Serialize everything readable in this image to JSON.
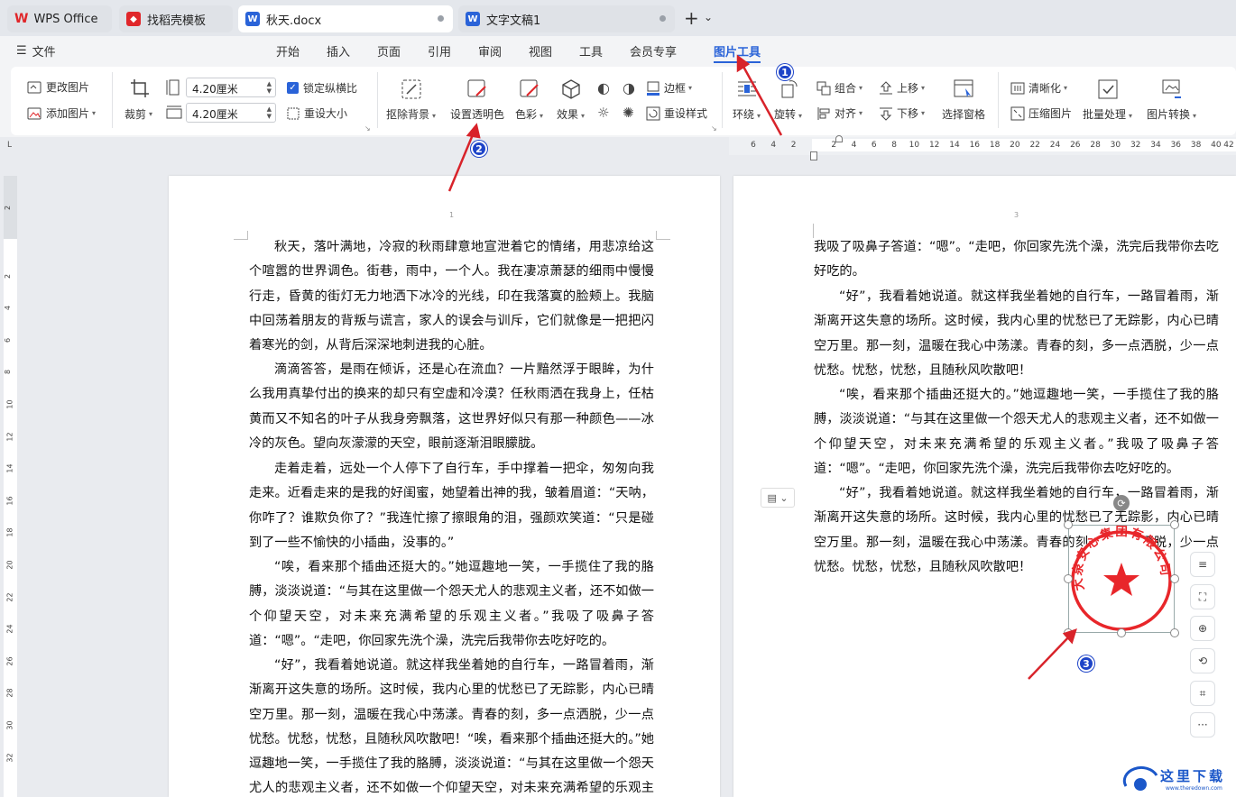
{
  "tabs": [
    {
      "label": "WPS Office",
      "icon": "wps-logo-icon"
    },
    {
      "label": "找稻壳模板",
      "icon": "docer-icon"
    },
    {
      "label": "秋天.docx",
      "icon": "word-doc-icon"
    },
    {
      "label": "文字文稿1",
      "icon": "word-doc-icon"
    }
  ],
  "tab_actions": {
    "new_tab": "+",
    "menu": "⌄"
  },
  "menu": {
    "file": "文件",
    "items": [
      "开始",
      "插入",
      "页面",
      "引用",
      "审阅",
      "视图",
      "工具",
      "会员专享",
      "图片工具"
    ],
    "active": "图片工具"
  },
  "ribbon": {
    "change_picture": "更改图片",
    "add_picture": "添加图片",
    "crop": "裁剪",
    "height_value": "4.20厘米",
    "width_value": "4.20厘米",
    "lock_ratio": "锁定纵横比",
    "reset_size": "重设大小",
    "remove_bg": "抠除背景",
    "set_transparent": "设置透明色",
    "color": "色彩",
    "effect": "效果",
    "border": "边框",
    "reset_style": "重设样式",
    "wrap": "环绕",
    "rotate": "旋转",
    "group": "组合",
    "align": "对齐",
    "move_up": "上移",
    "move_down": "下移",
    "selection_pane": "选择窗格",
    "sharpen": "清晰化",
    "compress": "压缩图片",
    "batch": "批量处理",
    "convert": "图片转换"
  },
  "ruler": {
    "h": [
      "6",
      "4",
      "2",
      "2",
      "4",
      "6",
      "8",
      "10",
      "12",
      "14",
      "16",
      "18",
      "20",
      "22",
      "24",
      "26",
      "28",
      "30",
      "32",
      "34",
      "36",
      "38",
      "40",
      "42"
    ],
    "v": [
      "2",
      "2",
      "4",
      "6",
      "8",
      "10",
      "12",
      "14",
      "16",
      "18",
      "20",
      "22",
      "24",
      "26",
      "28",
      "30",
      "32"
    ]
  },
  "page1": {
    "page_number": "1",
    "paragraphs": [
      "秋天，落叶满地，冷寂的秋雨肆意地宣泄着它的情绪，用悲凉给这个喧嚣的世界调色。街巷，雨中，一个人。我在凄凉萧瑟的细雨中慢慢行走，昏黄的街灯无力地洒下冰冷的光线，印在我落寞的脸颊上。我脑中回荡着朋友的背叛与谎言，家人的误会与训斥，它们就像是一把把闪着寒光的剑，从背后深深地刺进我的心脏。",
      "滴滴答答，是雨在倾诉，还是心在流血？一片黯然浮于眼眸，为什么我用真挚付出的换来的却只有空虚和冷漠？任秋雨洒在我身上，任枯黄而又不知名的叶子从我身旁飘落，这世界好似只有那一种颜色——冰冷的灰色。望向灰濛濛的天空，眼前逐渐泪眼朦胧。",
      "走着走着，远处一个人停下了自行车，手中撑着一把伞，匆匆向我走来。近看走来的是我的好闺蜜，她望着出神的我，皱着眉道：“天呐，你咋了？谁欺负你了？”我连忙擦了擦眼角的泪，强颜欢笑道：“只是碰到了一些不愉快的小插曲，没事的。”",
      "“唉，看来那个插曲还挺大的。”她逗趣地一笑，一手揽住了我的胳膊，淡淡说道：“与其在这里做一个怨天尤人的悲观主义者，还不如做一个仰望天空，对未来充满希望的乐观主义者。”我吸了吸鼻子答道：“嗯”。“走吧，你回家先洗个澡，洗完后我带你去吃好吃的。",
      "“好”，我看着她说道。就这样我坐着她的自行车，一路冒着雨，渐渐离开这失意的场所。这时候，我内心里的忧愁已了无踪影，内心已晴空万里。那一刻，温暖在我心中荡漾。青春的刻，多一点洒脱，少一点忧愁。忧愁，忧愁，且随秋风吹散吧！“唉，看来那个插曲还挺大的。”她逗趣地一笑，一手揽住了我的胳膊，淡淡说道：“与其在这里做一个怨天尤人的悲观主义者，还不如做一个仰望天空，对未来充满希望的乐观主义者。"
    ]
  },
  "page2": {
    "page_number": "3",
    "paragraphs": [
      "我吸了吸鼻子答道：“嗯”。“走吧，你回家先洗个澡，洗完后我带你去吃好吃的。",
      "“好”，我看着她说道。就这样我坐着她的自行车，一路冒着雨，渐渐离开这失意的场所。这时候，我内心里的忧愁已了无踪影，内心已晴空万里。那一刻，温暖在我心中荡漾。青春的刻，多一点洒脱，少一点忧愁。忧愁，忧愁，且随秋风吹散吧！",
      "“唉，看来那个插曲还挺大的。”她逗趣地一笑，一手揽住了我的胳膊，淡淡说道：“与其在这里做一个怨天尤人的悲观主义者，还不如做一个仰望天空，对未来充满希望的乐观主义者。”我吸了吸鼻子答道：“嗯”。“走吧，你回家先洗个澡，洗完后我带你去吃好吃的。",
      "“好”，我看着她说道。就这样我坐着她的自行车，一路冒着雨，渐渐离开这失意的场所。这时候，我内心里的忧愁已了无踪影，内心已晴空万里。那一刻，温暖在我心中荡漾。青春的刻，多一点洒脱，少一点忧愁。忧愁，忧愁，且随秋风吹散吧！"
    ]
  },
  "seal": {
    "text": "大泉安心集团有限公司",
    "color": "#e8262a"
  },
  "annotations": [
    "1",
    "2",
    "3"
  ],
  "watermark": {
    "text": "这里下载",
    "url": "www.theredown.com"
  },
  "colors": {
    "accent": "#2a63d8",
    "badge": "#1e44c8",
    "arrow": "#d8232a"
  }
}
